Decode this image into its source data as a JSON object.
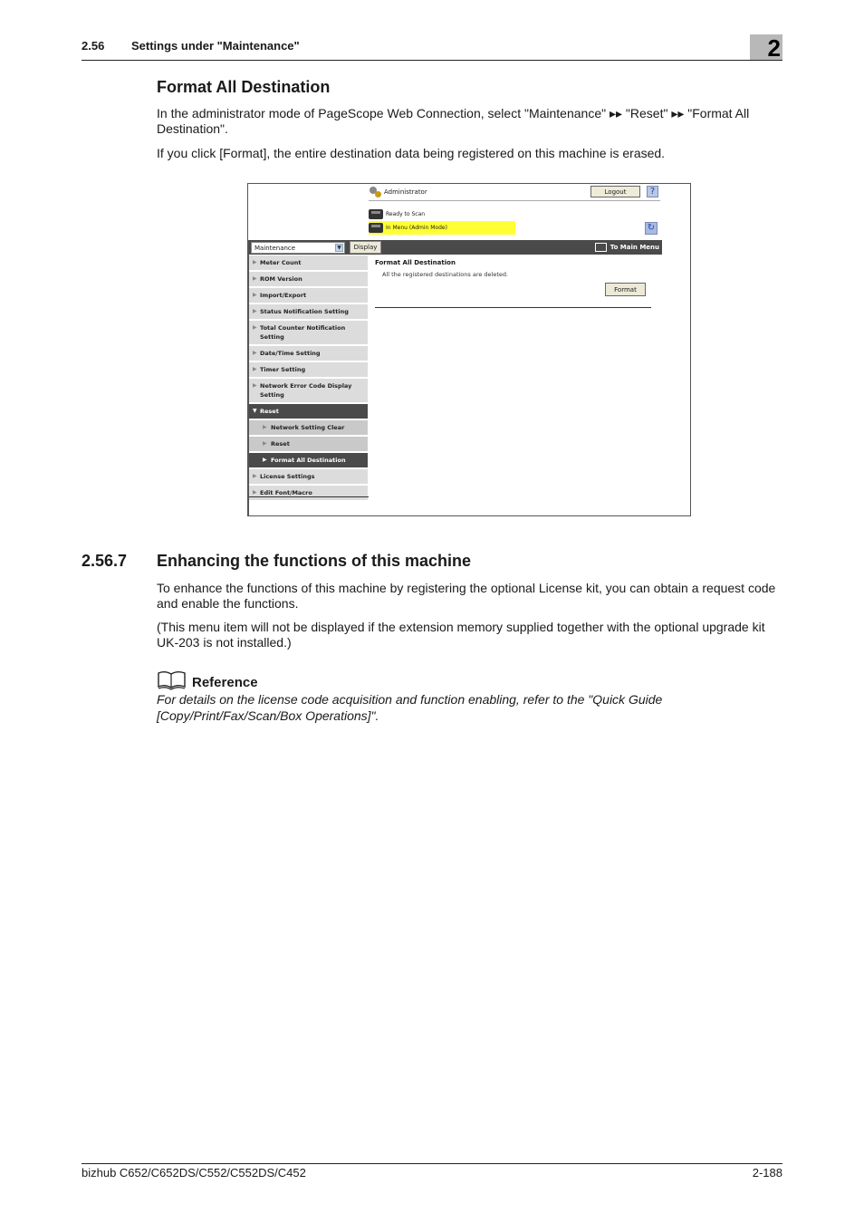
{
  "header": {
    "section_number": "2.56",
    "section_title": "Settings under \"Maintenance\"",
    "chapter_number": "2"
  },
  "format_all": {
    "heading": "Format All Destination",
    "paragraph1": "In the administrator mode of PageScope Web Connection, select \"Maintenance\" ▸▸ \"Reset\" ▸▸ \"Format All Destination\".",
    "paragraph2": "If you click [Format], the entire destination data being registered on this machine is erased."
  },
  "screenshot": {
    "user_label": "Administrator",
    "logout_label": "Logout",
    "help_label": "?",
    "status_ready": "Ready to Scan",
    "status_mode": "In Menu (Admin Mode)",
    "refresh_icon": "↻",
    "category_select": "Maintenance",
    "display_button": "Display",
    "to_main_menu": "To Main Menu",
    "menu": [
      {
        "label": "Meter Count",
        "level": 0,
        "state": "normal",
        "icon": "▶"
      },
      {
        "label": "ROM Version",
        "level": 0,
        "state": "normal",
        "icon": "▶"
      },
      {
        "label": "Import/Export",
        "level": 0,
        "state": "normal",
        "icon": "▶"
      },
      {
        "label": "Status Notification Setting",
        "level": 0,
        "state": "normal",
        "icon": "▶"
      },
      {
        "label": "Total Counter Notification Setting",
        "level": 0,
        "state": "normal",
        "icon": "▶"
      },
      {
        "label": "Date/Time Setting",
        "level": 0,
        "state": "normal",
        "icon": "▶"
      },
      {
        "label": "Timer Setting",
        "level": 0,
        "state": "normal",
        "icon": "▶"
      },
      {
        "label": "Network Error Code Display Setting",
        "level": 0,
        "state": "normal",
        "icon": "▶"
      },
      {
        "label": "Reset",
        "level": 0,
        "state": "expanded",
        "icon": "▼"
      },
      {
        "label": "Network Setting Clear",
        "level": 1,
        "state": "normal",
        "icon": "▶"
      },
      {
        "label": "Reset",
        "level": 1,
        "state": "normal",
        "icon": "▶"
      },
      {
        "label": "Format All Destination",
        "level": 1,
        "state": "selected",
        "icon": "▶"
      },
      {
        "label": "License Settings",
        "level": 0,
        "state": "normal",
        "icon": "▶"
      },
      {
        "label": "Edit Font/Macro",
        "level": 0,
        "state": "normal",
        "icon": "▶"
      }
    ],
    "content_title": "Format All Destination",
    "content_description": "All the registered destinations are deleted.",
    "format_button": "Format"
  },
  "enhancing": {
    "number": "2.56.7",
    "heading": "Enhancing the functions of this machine",
    "paragraph1": "To enhance the functions of this machine by registering the optional License kit, you can obtain a request code and enable the functions.",
    "paragraph2": "(This menu item will not be displayed if the extension memory supplied together with the optional upgrade kit UK-203 is not installed.)"
  },
  "reference": {
    "label": "Reference",
    "text": "For details on the license code acquisition and function enabling, refer to the \"Quick Guide [Copy/Print/Fax/Scan/Box Operations]\"."
  },
  "footer": {
    "product": "bizhub C652/C652DS/C552/C552DS/C452",
    "page": "2-188"
  }
}
